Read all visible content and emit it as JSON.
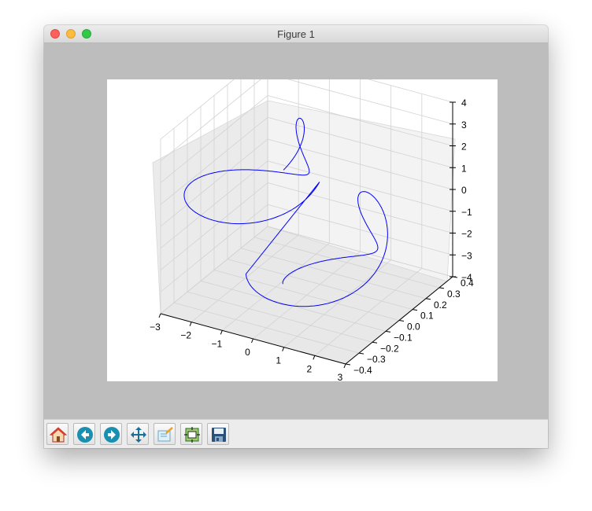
{
  "window": {
    "title": "Figure 1"
  },
  "toolbar": {
    "buttons": [
      {
        "name": "home-button",
        "icon": "home-icon"
      },
      {
        "name": "back-button",
        "icon": "back-arrow-icon"
      },
      {
        "name": "forward-button",
        "icon": "forward-arrow-icon"
      },
      {
        "name": "pan-button",
        "icon": "move-arrows-icon"
      },
      {
        "name": "zoom-button",
        "icon": "zoom-rect-icon"
      },
      {
        "name": "subplots-button",
        "icon": "configure-subplots-icon"
      },
      {
        "name": "save-button",
        "icon": "floppy-disk-icon"
      }
    ]
  },
  "colors": {
    "line": "#0000ff",
    "pane": "#f2f2f2",
    "window_bg": "#bdbdbd"
  },
  "chart_data": {
    "type": "line",
    "projection": "3d",
    "x_ticks": [
      "−3",
      "−2",
      "−1",
      "0",
      "1",
      "2",
      "3"
    ],
    "y_ticks": [
      "−0.4",
      "−0.3",
      "−0.2",
      "−0.1",
      "0.0",
      "0.1",
      "0.2",
      "0.3",
      "0.4"
    ],
    "z_ticks": [
      "−4",
      "−3",
      "−2",
      "−1",
      "0",
      "1",
      "2",
      "3",
      "4"
    ],
    "xlim": [
      -3,
      3
    ],
    "ylim": [
      -0.4,
      0.4
    ],
    "zlim": [
      -4,
      4
    ],
    "grid": true,
    "series": [
      {
        "color": "#0000ff",
        "shape": "double spiral (figure-eight) curve: upper-left loop around x≈-1.2, z≈1.5 and lower-right loop around x≈1.2, z≈-1.5"
      }
    ]
  }
}
